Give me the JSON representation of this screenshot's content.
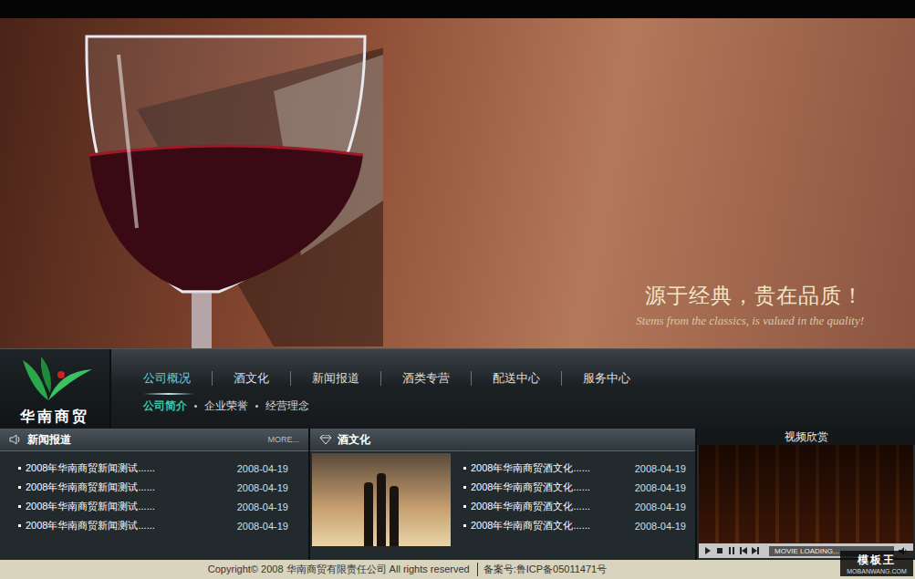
{
  "banner": {
    "slogan": "源于经典，贵在品质！",
    "slogan_en": "Stems from the classics, is valued in the quality!"
  },
  "logo": {
    "name": "华南商贸"
  },
  "nav": {
    "items": [
      {
        "label": "公司概况",
        "selected": true
      },
      {
        "label": "酒文化",
        "selected": false
      },
      {
        "label": "新闻报道",
        "selected": false
      },
      {
        "label": "酒类专营",
        "selected": false
      },
      {
        "label": "配送中心",
        "selected": false
      },
      {
        "label": "服务中心",
        "selected": false
      }
    ]
  },
  "subnav": {
    "items": [
      {
        "label": "公司简介",
        "selected": true
      },
      {
        "label": "企业荣誉",
        "selected": false
      },
      {
        "label": "经营理念",
        "selected": false
      }
    ]
  },
  "news": {
    "title": "新闻报道",
    "more": "MORE...",
    "rows": [
      {
        "title": "2008年华南商贸新闻测试......",
        "date": "2008-04-19"
      },
      {
        "title": "2008年华南商贸新闻测试......",
        "date": "2008-04-19"
      },
      {
        "title": "2008年华南商贸新闻测试......",
        "date": "2008-04-19"
      },
      {
        "title": "2008年华南商贸新闻测试......",
        "date": "2008-04-19"
      }
    ]
  },
  "culture": {
    "title": "酒文化",
    "rows": [
      {
        "title": "2008年华南商贸酒文化......",
        "date": "2008-04-19"
      },
      {
        "title": "2008年华南商贸酒文化......",
        "date": "2008-04-19"
      },
      {
        "title": "2008年华南商贸酒文化......",
        "date": "2008-04-19"
      },
      {
        "title": "2008年华南商贸酒文化......",
        "date": "2008-04-19"
      }
    ]
  },
  "video": {
    "title": "视频欣赏",
    "status": "MOVIE LOADING..."
  },
  "footer": {
    "copyright": "Copyright© 2008 华南商贸有限责任公司 All rights reserved",
    "icp": "备案号:鲁ICP备05011471号"
  },
  "watermark": {
    "name": "模板王",
    "url": "MOBANWANG.COM"
  }
}
